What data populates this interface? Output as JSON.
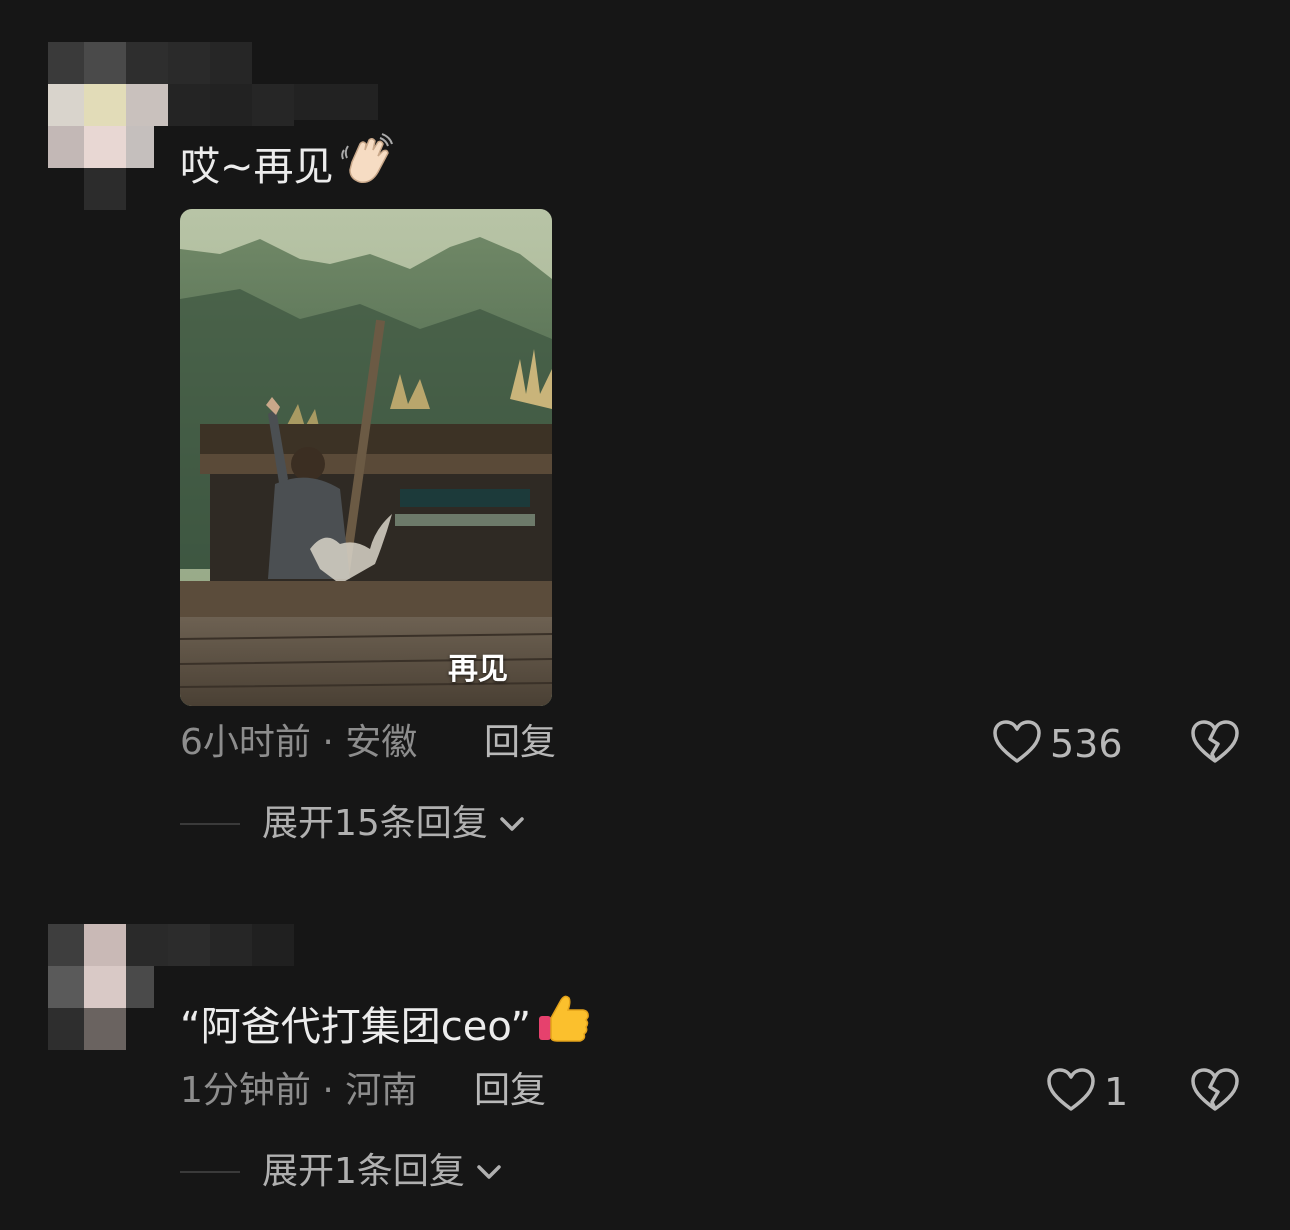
{
  "comments": [
    {
      "text": "哎~再见",
      "emoji": "waving-hand",
      "image_caption": "再见",
      "meta": "6小时前 · 安徽",
      "reply_label": "回复",
      "likes": "536",
      "expand_label": "展开15条回复"
    },
    {
      "text": "“阿爸代打集团ceo”",
      "emoji": "thumbs-up",
      "meta": "1分钟前 · 河南",
      "reply_label": "回复",
      "likes": "1",
      "expand_label": "展开1条回复"
    }
  ],
  "icons": {
    "like": "heart-outline-icon",
    "dislike": "broken-heart-icon",
    "expand": "chevron-down-icon"
  },
  "colors": {
    "background": "#161616",
    "text_primary": "#ececec",
    "text_secondary": "#8d8d8d"
  }
}
